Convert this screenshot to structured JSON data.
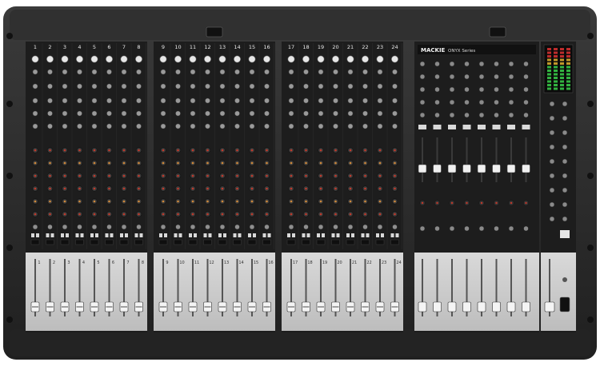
{
  "product": {
    "brand_label": "MACKIE",
    "model_label": "ONYX Series"
  },
  "sections": {
    "bank1_labels": [
      "1",
      "2",
      "3",
      "4",
      "5",
      "6",
      "7",
      "8"
    ],
    "bank2_labels": [
      "9",
      "10",
      "11",
      "12",
      "13",
      "14",
      "15",
      "16"
    ],
    "bank3_labels": [
      "17",
      "18",
      "19",
      "20",
      "21",
      "22",
      "23",
      "24"
    ]
  },
  "colors": {
    "chassis": "#2b2b2b",
    "panel": "#1c1c1c",
    "fader_bay": "#cfcfcf",
    "knob_eq_accent": "#c0392b",
    "knob_aux_accent": "#d08a3a",
    "led_green": "#39d04a"
  },
  "icons": {
    "control_knob": "knob-icon",
    "fader_cap": "fader-cap-icon",
    "mute_button": "button-icon",
    "meter": "led-meter-icon"
  }
}
